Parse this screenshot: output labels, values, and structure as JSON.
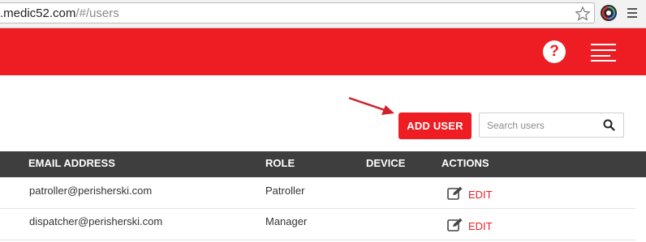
{
  "browser": {
    "url_host": ".medic52.com",
    "url_path": "/#/users"
  },
  "header": {
    "help_label": "?"
  },
  "toolbar": {
    "add_user_label": "ADD USER",
    "search_placeholder": "Search users",
    "search_value": ""
  },
  "table": {
    "columns": [
      "EMAIL ADDRESS",
      "ROLE",
      "DEVICE",
      "ACTIONS"
    ],
    "rows": [
      {
        "email": "patroller@perisherski.com",
        "role": "Patroller",
        "device": "",
        "action": "EDIT"
      },
      {
        "email": "dispatcher@perisherski.com",
        "role": "Manager",
        "device": "",
        "action": "EDIT"
      }
    ]
  },
  "colors": {
    "brand_red": "#ee1d23",
    "table_header_bg": "#3e3e3e",
    "arrow": "#d0202a"
  },
  "icons": [
    "star-icon",
    "extension-icon",
    "browser-menu-icon",
    "help-icon",
    "hamburger-icon",
    "search-icon",
    "edit-icon"
  ]
}
